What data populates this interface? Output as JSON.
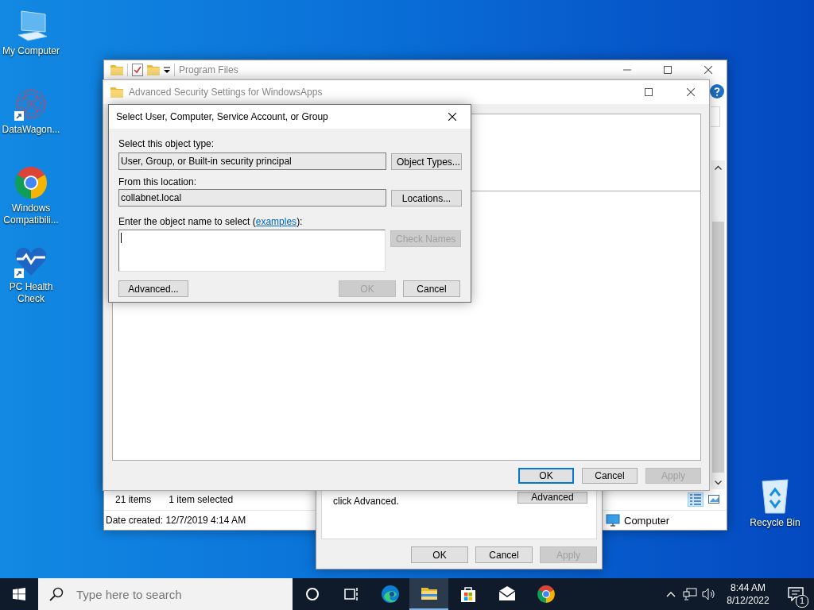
{
  "desktop_icons": [
    {
      "label": "My Computer",
      "kind": "computer",
      "shortcut": false
    },
    {
      "label": "DataWagon...",
      "kind": "dot-pattern",
      "shortcut": true
    },
    {
      "label": "Windows Compatibili...",
      "kind": "chrome",
      "shortcut": false
    },
    {
      "label": "PC Health Check",
      "kind": "heart",
      "shortcut": true
    }
  ],
  "recycle_bin": {
    "label": "Recycle Bin"
  },
  "explorer": {
    "title": "Program Files",
    "item_count": "21 items",
    "selection": "1 item selected",
    "date_created": "Date created: 12/7/2019 4:14 AM",
    "location": "Computer",
    "views": [
      {
        "kind": "details",
        "selected": true
      },
      {
        "kind": "large-icons",
        "selected": false
      }
    ]
  },
  "properties": {
    "note": "click Advanced.",
    "advanced": {
      "label": "Advanced",
      "disabled": false
    },
    "ok": {
      "label": "OK",
      "disabled": false
    },
    "cancel": {
      "label": "Cancel",
      "disabled": false
    },
    "apply": {
      "label": "Apply",
      "disabled": true
    }
  },
  "security": {
    "title": "Advanced Security Settings for WindowsApps",
    "ok": {
      "label": "OK",
      "disabled": false,
      "default": true
    },
    "cancel": {
      "label": "Cancel",
      "disabled": false,
      "default": false
    },
    "apply": {
      "label": "Apply",
      "disabled": true,
      "default": false
    }
  },
  "dialog": {
    "title": "Select User, Computer, Service Account, or Group",
    "object_type_label": "Select this object type:",
    "object_type": "User, Group, or Built-in security principal",
    "object_types": {
      "label": "Object Types...",
      "disabled": false
    },
    "location_label": "From this location:",
    "location": "collabnet.local",
    "locations": {
      "label": "Locations...",
      "disabled": false
    },
    "name_label": {
      "before": "Enter the object name to select (",
      "link": "examples",
      "after": "):"
    },
    "check_names": {
      "label": "Check Names",
      "disabled": true
    },
    "advanced": {
      "label": "Advanced...",
      "disabled": false
    },
    "ok": {
      "label": "OK",
      "disabled": true
    },
    "cancel": {
      "label": "Cancel",
      "disabled": false
    }
  },
  "taskbar": {
    "search_placeholder": "Type here to search",
    "apps": [
      {
        "kind": "cortana",
        "active": false
      },
      {
        "kind": "task-view",
        "active": false
      },
      {
        "kind": "edge",
        "active": false
      },
      {
        "kind": "file-explorer",
        "active": true
      },
      {
        "kind": "store",
        "active": false
      },
      {
        "kind": "mail",
        "active": false
      },
      {
        "kind": "chrome",
        "active": false
      }
    ],
    "time": "8:44 AM",
    "date": "8/12/2022",
    "notification_count": "1"
  }
}
